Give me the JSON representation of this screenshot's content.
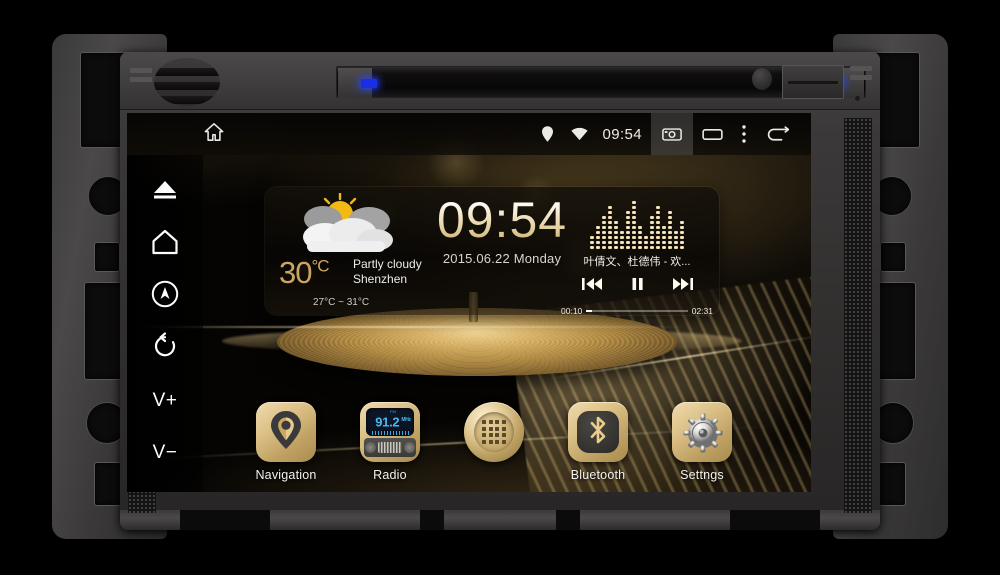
{
  "device": {
    "type": "android-car-head-unit",
    "brand_colors": {
      "accent_gold": "#cba661",
      "led_blue": "#1a2ee8",
      "radio_cyan": "#48b9f0"
    }
  },
  "status_bar": {
    "home_icon": "home-icon",
    "location_icon": "location-pin-icon",
    "wifi_icon": "wifi-icon",
    "clock": "09:54",
    "screenshot_icon": "screenshot-camera-icon",
    "recents_icon": "recent-apps-icon",
    "overflow_icon": "overflow-menu-icon",
    "back_icon": "back-arrow-icon"
  },
  "sidebar": {
    "items": [
      {
        "name": "eject",
        "icon": "eject-icon",
        "label": ""
      },
      {
        "name": "home",
        "icon": "home-icon",
        "label": ""
      },
      {
        "name": "navigation",
        "icon": "compass-icon",
        "label": ""
      },
      {
        "name": "power",
        "icon": "power-reset-icon",
        "label": ""
      },
      {
        "name": "volume-up",
        "icon": "text",
        "label": "V+"
      },
      {
        "name": "volume-down",
        "icon": "text",
        "label": "V−"
      }
    ]
  },
  "widget": {
    "weather": {
      "temperature": "30",
      "unit": "°C",
      "condition": "Partly cloudy",
      "city": "Shenzhen",
      "range": "27°C ~ 31°C",
      "icon": "sun-behind-cloud-icon"
    },
    "clock": {
      "time": "09:54",
      "date": "2015.06.22 Monday"
    },
    "music": {
      "track": "叶倩文、杜德伟 - 欢...",
      "elapsed": "00:10",
      "duration": "02:31",
      "progress_percent": 6,
      "prev_icon": "previous-track-icon",
      "play_pause_icon": "pause-icon",
      "next_icon": "next-track-icon",
      "visualizer": "equalizer-bars"
    }
  },
  "dock": {
    "apps": [
      {
        "label": "Navigation",
        "icon": "map-pin-icon"
      },
      {
        "label": "Radio",
        "icon": "fm-radio-icon",
        "frequency": "91.2",
        "band": "FM",
        "unit": "MHz"
      },
      {
        "label": "",
        "icon": "app-drawer-grid-icon"
      },
      {
        "label": "Bluetooth",
        "icon": "bluetooth-icon"
      },
      {
        "label": "Settngs",
        "icon": "gear-icon"
      }
    ]
  },
  "hardware": {
    "disc_slot": "cd-dvd-slot",
    "led_left": "blue-indicator-led",
    "led_right": "blue-indicator-led",
    "speaker_grille": "speaker-grille",
    "reset_button": "reset-button",
    "card_slot": "sd-usb-card-slot"
  }
}
